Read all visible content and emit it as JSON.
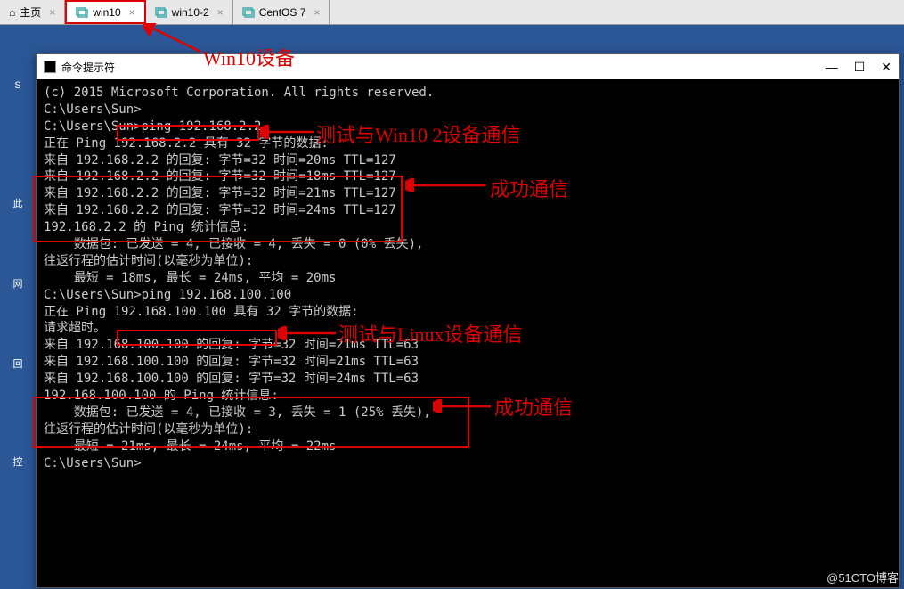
{
  "tabs": {
    "home": "主页",
    "win10": "win10",
    "win10_2": "win10-2",
    "centos": "CentOS 7"
  },
  "cmd_title": "命令提示符",
  "title_controls": {
    "min": "—",
    "max": "☐",
    "close": "✕"
  },
  "terminal": {
    "copyright": "(c) 2015 Microsoft Corporation. All rights reserved.",
    "blank": "",
    "prompt1": "C:\\Users\\Sun>",
    "prompt2_pre": "C:\\Users\\Sun>",
    "cmd_ping1": "ping 192.168.2.2",
    "ping1_header": "正在 Ping 192.168.2.2 具有 32 字节的数据:",
    "ping1_r1": "来自 192.168.2.2 的回复: 字节=32 时间=20ms TTL=127",
    "ping1_r2": "来自 192.168.2.2 的回复: 字节=32 时间=18ms TTL=127",
    "ping1_r3": "来自 192.168.2.2 的回复: 字节=32 时间=21ms TTL=127",
    "ping1_r4": "来自 192.168.2.2 的回复: 字节=32 时间=24ms TTL=127",
    "ping1_stats_header": "192.168.2.2 的 Ping 统计信息:",
    "ping1_stats_pkts": "    数据包: 已发送 = 4, 已接收 = 4, 丢失 = 0 (0% 丢失),",
    "ping1_rtt_header": "往返行程的估计时间(以毫秒为单位):",
    "ping1_rtt": "    最短 = 18ms, 最长 = 24ms, 平均 = 20ms",
    "cmd_ping2": "ping 192.168.100.100",
    "ping2_header": "正在 Ping 192.168.100.100 具有 32 字节的数据:",
    "ping2_timeout": "请求超时。",
    "ping2_r1": "来自 192.168.100.100 的回复: 字节=32 时间=21ms TTL=63",
    "ping2_r2": "来自 192.168.100.100 的回复: 字节=32 时间=21ms TTL=63",
    "ping2_r3": "来自 192.168.100.100 的回复: 字节=32 时间=24ms TTL=63",
    "ping2_stats_header": "192.168.100.100 的 Ping 统计信息:",
    "ping2_stats_pkts": "    数据包: 已发送 = 4, 已接收 = 3, 丢失 = 1 (25% 丢失),",
    "ping2_rtt_header": "往返行程的估计时间(以毫秒为单位):",
    "ping2_rtt": "    最短 = 21ms, 最长 = 24ms, 平均 = 22ms",
    "prompt_end": "C:\\Users\\Sun>"
  },
  "annotations": {
    "win10_device": "Win10设备",
    "test_win10_2": "测试与Win10 2设备通信",
    "success1": "成功通信",
    "test_linux": "测试与Linux设备通信",
    "success2": "成功通信"
  },
  "desktop": {
    "s": "S",
    "ci": "此",
    "wang": "网",
    "hui": "回",
    "kong": "控"
  },
  "watermark": "@51CTO博客"
}
